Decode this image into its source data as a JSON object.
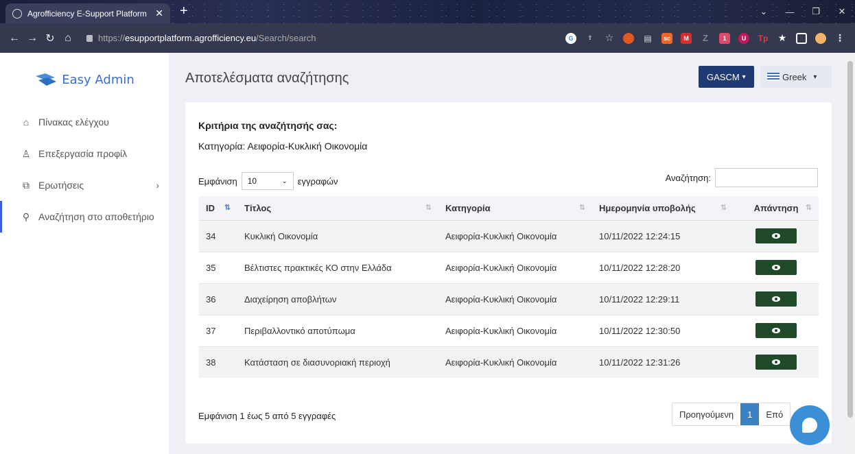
{
  "browser": {
    "tab_title": "Agrofficiency E-Support Platform",
    "url_prefix": "https://",
    "url_host": "esupportplatform.agrofficiency.eu",
    "url_path": "/Search/search"
  },
  "sidebar": {
    "brand": "Easy Admin",
    "items": [
      {
        "label": "Πίνακας ελέγχου",
        "icon": "home-icon"
      },
      {
        "label": "Επεξεργασία προφίλ",
        "icon": "user-icon"
      },
      {
        "label": "Ερωτήσεις",
        "icon": "questions-icon",
        "has_submenu": true
      },
      {
        "label": "Αναζήτηση στο αποθετήριο",
        "icon": "search-icon",
        "active": true
      }
    ]
  },
  "header": {
    "title": "Αποτελέσματα αναζήτησης",
    "org_button": "GASCM",
    "language": "Greek"
  },
  "criteria": {
    "heading": "Κριτήρια της αναζήτησής σας:",
    "category_line": "Κατηγορία: Αειφορία-Κυκλική Οικονομία"
  },
  "table_controls": {
    "show_label": "Εμφάνιση",
    "page_size": "10",
    "records_label": "εγγραφών",
    "search_label": "Αναζήτηση:"
  },
  "table": {
    "columns": [
      "ID",
      "Τίτλος",
      "Κατηγορία",
      "Ημερομηνία υποβολής",
      "Απάντηση"
    ],
    "rows": [
      {
        "id": "34",
        "title": "Κυκλική Οικονομία",
        "category": "Αειφορία-Κυκλική Οικονομία",
        "date": "10/11/2022 12:24:15"
      },
      {
        "id": "35",
        "title": "Βέλτιστες πρακτικές ΚΟ στην Ελλάδα",
        "category": "Αειφορία-Κυκλική Οικονομία",
        "date": "10/11/2022 12:28:20"
      },
      {
        "id": "36",
        "title": "Διαχείρηση αποβλήτων",
        "category": "Αειφορία-Κυκλική Οικονομία",
        "date": "10/11/2022 12:29:11"
      },
      {
        "id": "37",
        "title": "Περιβαλλοντικό αποτύπωμα",
        "category": "Αειφορία-Κυκλική Οικονομία",
        "date": "10/11/2022 12:30:50"
      },
      {
        "id": "38",
        "title": "Κατάσταση σε διασυνοριακή περιοχή",
        "category": "Αειφορία-Κυκλική Οικονομία",
        "date": "10/11/2022 12:31:26"
      }
    ]
  },
  "footer": {
    "info": "Εμφάνιση 1 έως 5 από 5 εγγραφές",
    "prev": "Προηγούμενη",
    "current_page": "1",
    "next": "Επό"
  },
  "colors": {
    "brand_blue": "#3a6ec9",
    "org_button": "#1f3a73",
    "answer_button": "#1e4a2a",
    "active_page": "#3b82c4",
    "chat_bubble": "#3a8fd6"
  }
}
